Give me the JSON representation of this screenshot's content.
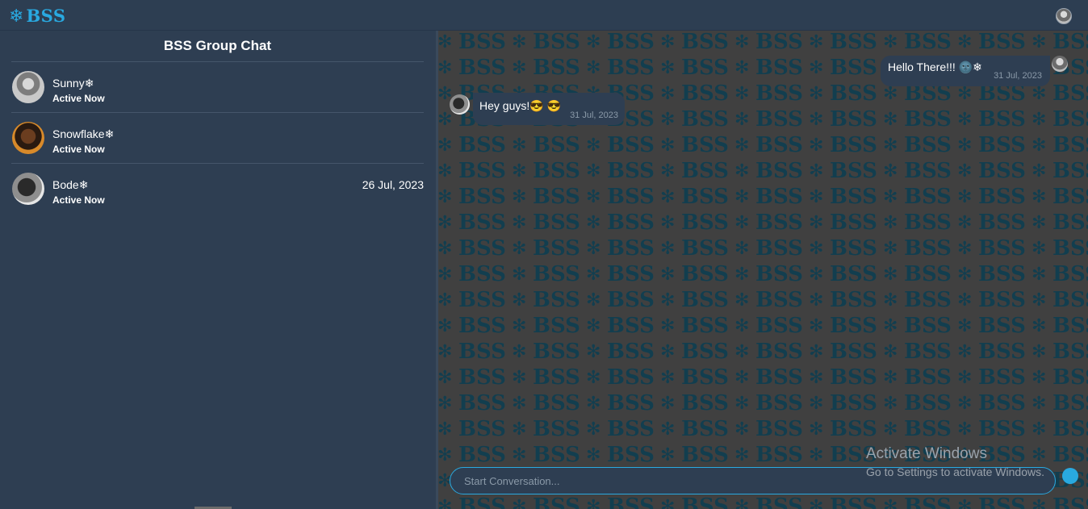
{
  "app": {
    "logo_text": "BSS",
    "logo_icon": "snowflake-icon",
    "accent_color": "#29a9e0",
    "background_color": "#2e3e52"
  },
  "sidebar": {
    "title": "BSS Group Chat",
    "contacts": [
      {
        "name": "Sunny❄",
        "status": "Active Now",
        "date": "",
        "avatar": "avatar-sunny"
      },
      {
        "name": "Snowflake❄",
        "status": "Active Now",
        "date": "",
        "avatar": "avatar-snowflake"
      },
      {
        "name": "Bode❄",
        "status": "Active Now",
        "date": "26 Jul, 2023",
        "avatar": "avatar-bode"
      }
    ]
  },
  "chat": {
    "background_pattern_text": "BSS",
    "messages": [
      {
        "direction": "outgoing",
        "text": "Hello There!!! 🌚❄",
        "time": "31 Jul, 2023"
      },
      {
        "direction": "incoming",
        "text": "Hey guys!😎 😎",
        "time": "31 Jul, 2023"
      }
    ],
    "composer": {
      "placeholder": "Start Conversation...",
      "value": ""
    }
  },
  "watermark": {
    "title": "Activate Windows",
    "subtitle": "Go to Settings to activate Windows."
  }
}
